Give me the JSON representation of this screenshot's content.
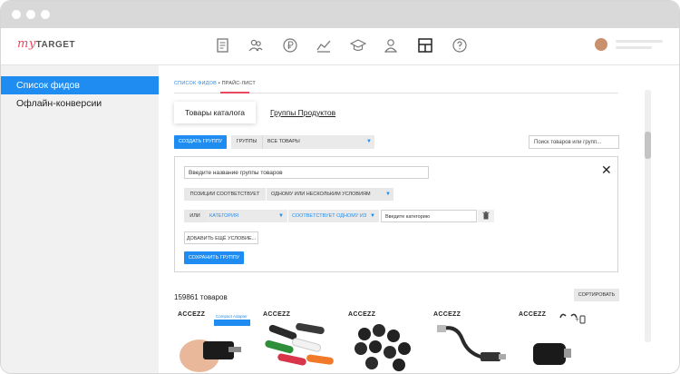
{
  "logo": {
    "my": "my",
    "target": "TARGET"
  },
  "nav_icons": [
    "document-icon",
    "people-icon",
    "ruble-icon",
    "chart-line-icon",
    "graduation-cap-icon",
    "user-icon",
    "layout-icon",
    "help-icon"
  ],
  "sidebar": {
    "items": [
      {
        "label": "Список фидов",
        "active": true
      },
      {
        "label": "Офлайн-конверсии",
        "active": false
      }
    ]
  },
  "breadcrumb": {
    "link": "СПИСОК ФИДОВ",
    "separator": "•",
    "current": "ПРАЙС-ЛИСТ"
  },
  "tabs": [
    {
      "label": "Товары каталога",
      "selected": true
    },
    {
      "label": "Группы Продуктов",
      "selected": false
    }
  ],
  "toolbar": {
    "create_group": "СОЗДАТЬ ГРУППУ",
    "groups_label": "ГРУППЫ",
    "groups_value": "ВСЕ ТОВАРЫ",
    "search_placeholder": "Поиск товаров или групп..."
  },
  "group_form": {
    "name_placeholder": "Введите название группы товаров",
    "match_label": "ПОЗИЦИИ СООТВЕТСТВУЕТ",
    "match_value": "ОДНОМУ ИЛИ НЕСКОЛЬКИМ УСЛОВИЯМ",
    "rule": {
      "logic": "ИЛИ",
      "field": "КАТЕГОРИЯ",
      "operator": "СООТВЕТСТВУЕТ ОДНОМУ ИЗ",
      "value_placeholder": "Введите категорию"
    },
    "add_condition": "ДОБАВИТЬ ЕЩЁ УСЛОВИЕ...",
    "save": "СОХРАНИТЬ ГРУППУ"
  },
  "products": {
    "count_label": "159861 товаров",
    "sort_label": "СОРТИРОВАТЬ",
    "cards": [
      {
        "brand": "ACCEZZ",
        "badge": "Compact Adapter",
        "image": "adapter-in-hand"
      },
      {
        "brand": "ACCEZZ",
        "image": "cable-clips-colored"
      },
      {
        "brand": "ACCEZZ",
        "image": "cable-clips-black"
      },
      {
        "brand": "ACCEZZ",
        "image": "usb-cable-adapter"
      },
      {
        "brand": "ACCEZZ",
        "image": "black-dongle"
      }
    ]
  },
  "colors": {
    "accent": "#1e8cf0",
    "brand_red": "#e84a5f"
  }
}
